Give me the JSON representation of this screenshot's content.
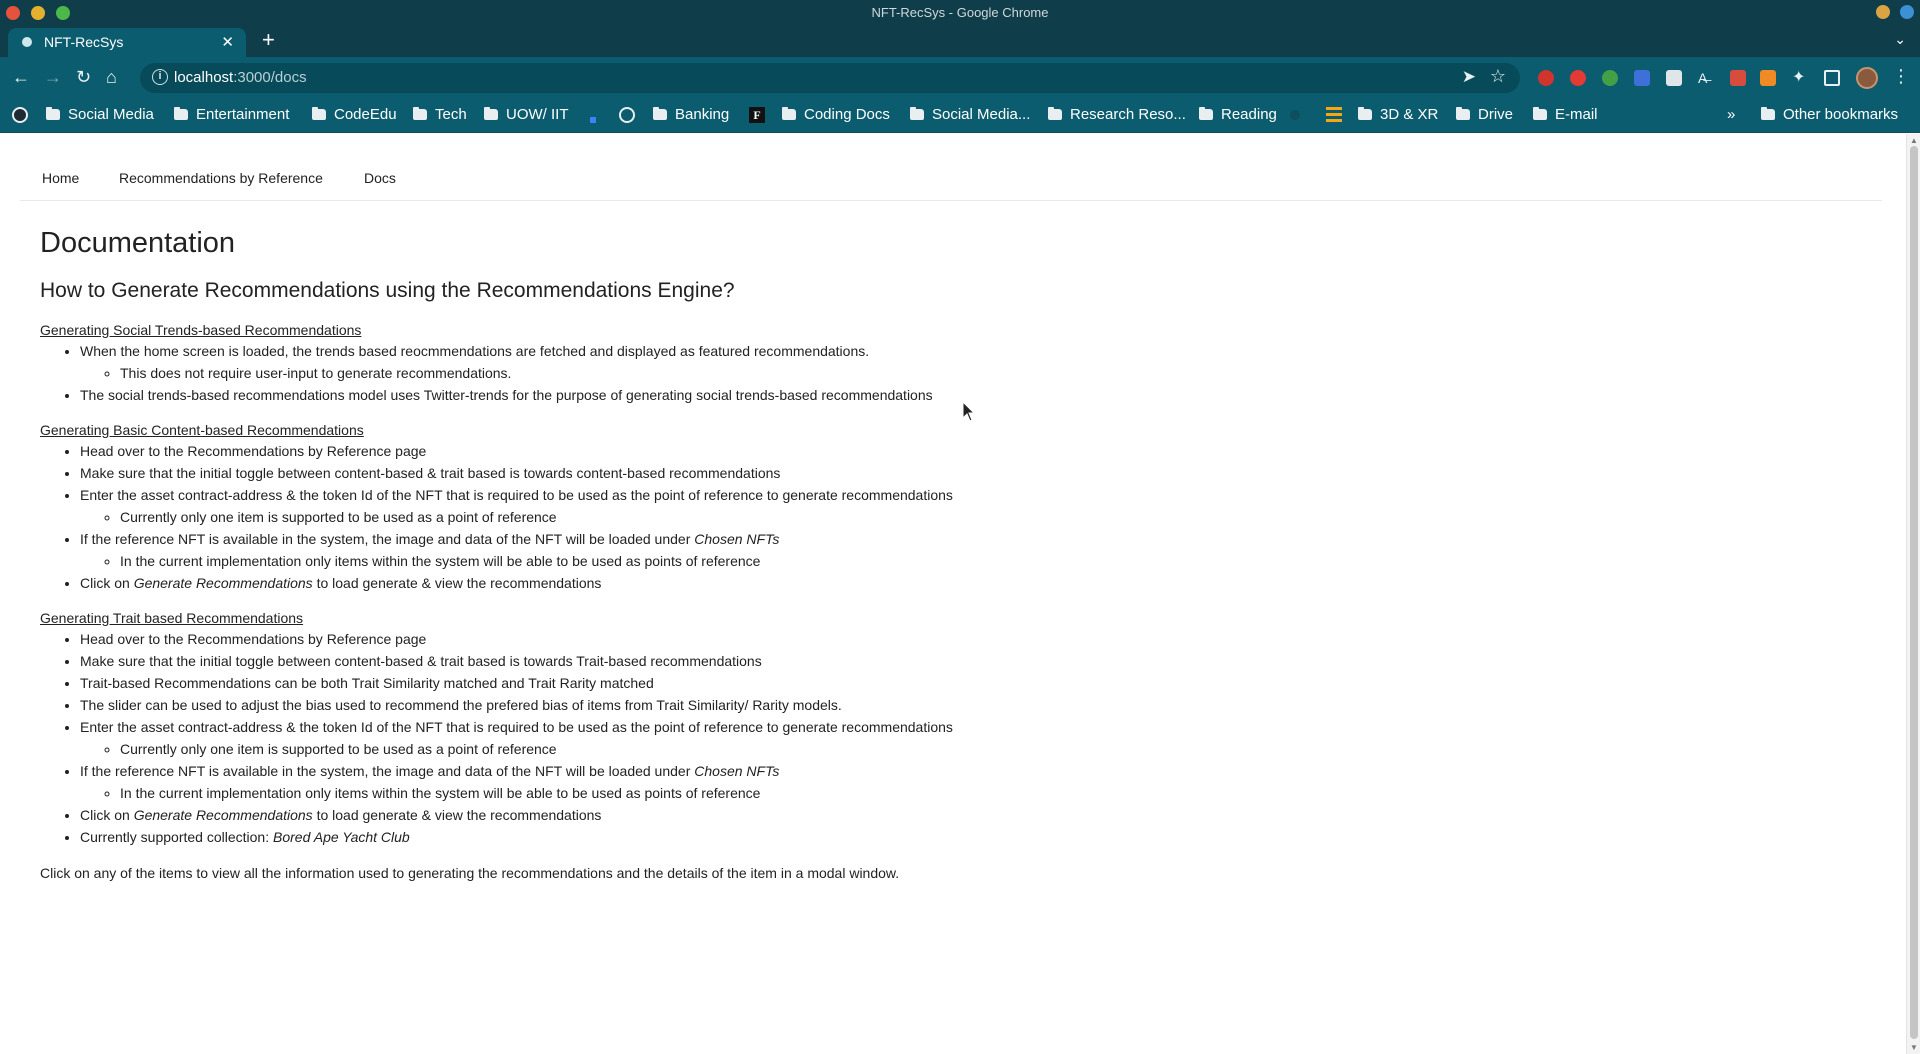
{
  "window": {
    "title": "NFT-RecSys - Google Chrome"
  },
  "tabs": [
    {
      "label": "NFT-RecSys",
      "close": "✕"
    }
  ],
  "toolbar": {
    "url_host": "localhost",
    "url_path": ":3000/docs"
  },
  "bookmarks": {
    "items": [
      "Social Media",
      "Entertainment",
      "CodeEdu",
      "Tech",
      "UOW/ IIT",
      "Banking",
      "Coding Docs",
      "Social Media...",
      "Research Reso...",
      "Reading",
      "3D & XR",
      "Drive",
      "E-mail"
    ],
    "overflow": "»",
    "other": "Other bookmarks"
  },
  "sitenav": {
    "home": "Home",
    "recs": "Recommendations by Reference",
    "docs": "Docs"
  },
  "doc": {
    "title": "Documentation",
    "subtitle": "How to Generate Recommendations using the Recommendations Engine?",
    "s1": {
      "heading": "Generating Social Trends-based Recommendations",
      "b1": "When the home screen is loaded, the trends based reocmmendations are fetched and displayed as featured recommendations.",
      "b1_sub": "This does not require user-input to generate recommendations.",
      "b2": "The social trends-based recommendations model uses Twitter-trends for the purpose of generating social trends-based recommendations"
    },
    "s2": {
      "heading": "Generating Basic Content-based Recommendations",
      "b1": "Head over to the Recommendations by Reference page",
      "b2": "Make sure that the initial toggle between content-based & trait based is towards content-based recommendations",
      "b3": "Enter the asset contract-address & the token Id of the NFT that is required to be used as the point of reference to generate recommendations",
      "b3_sub": "Currently only one item is supported to be used as a point of reference",
      "b4_pre": "If the reference NFT is available in the system, the image and data of the NFT will be loaded under ",
      "b4_em": "Chosen NFTs",
      "b4_sub": "In the current implementation only items within the system will be able to be used as points of reference",
      "b5_pre": "Click on ",
      "b5_em": "Generate Recommendations",
      "b5_post": " to load generate & view the recommendations"
    },
    "s3": {
      "heading": "Generating Trait based Recommendations",
      "b1": "Head over to the Recommendations by Reference page",
      "b2": "Make sure that the initial toggle between content-based & trait based is towards Trait-based recommendations",
      "b3": "Trait-based Recommendations can be both Trait Similarity matched and Trait Rarity matched",
      "b4": "The slider can be used to adjust the bias used to recommend the prefered bias of items from Trait Similarity/ Rarity models.",
      "b5": "Enter the asset contract-address & the token Id of the NFT that is required to be used as the point of reference to generate recommendations",
      "b5_sub": "Currently only one item is supported to be used as a point of reference",
      "b6_pre": "If the reference NFT is available in the system, the image and data of the NFT will be loaded under ",
      "b6_em": "Chosen NFTs",
      "b6_sub": "In the current implementation only items within the system will be able to be used as points of reference",
      "b7_pre": "Click on ",
      "b7_em": "Generate Recommendations",
      "b7_post": " to load generate & view the recommendations",
      "b8_pre": "Currently supported collection: ",
      "b8_em": "Bored Ape Yacht Club"
    },
    "closing": "Click on any of the items to view all the information used to generating the recommendations and the details of the item in a modal window."
  }
}
